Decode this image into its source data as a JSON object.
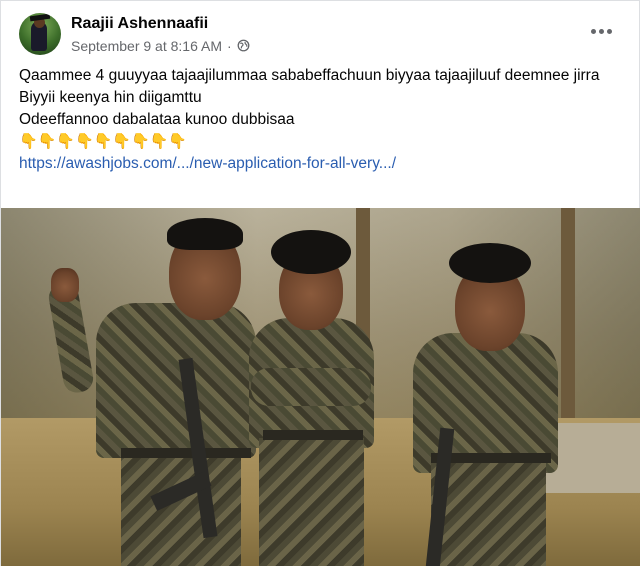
{
  "post": {
    "author": "Raajii Ashennaafii",
    "timestamp": "September 9 at 8:16 AM",
    "separator": "·",
    "privacy_icon": "globe-icon",
    "more_icon": "more-options-icon",
    "lines": [
      "Qaammee 4 guuyyaa tajaajilummaa sababeffachuun biyyaa tajaajiluuf deemnee jirra",
      "Biyyii keenya hin diigamttu",
      "Odeeffannoo dabalataa kunoo dubbisaa"
    ],
    "emoji_row": "👇👇👇👇👇👇👇👇👇",
    "link_text": "https://awashjobs.com/.../new-application-for-all-very.../"
  },
  "colors": {
    "link": "#2a5db0",
    "secondary_text": "#65676b",
    "primary_text": "#050505"
  }
}
